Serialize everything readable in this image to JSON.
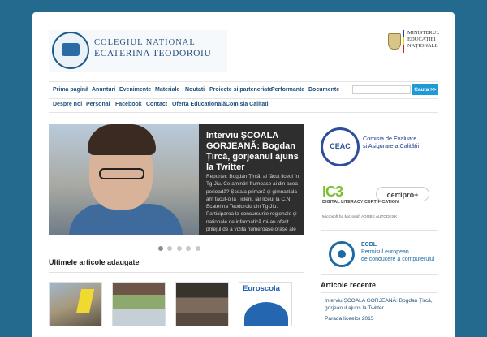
{
  "site": {
    "logo_line1": "COLEGIUL NATIONAL",
    "logo_line2": "ECATERINA TEODOROIU",
    "ministry_line1": "MINISTERUL",
    "ministry_line2": "EDUCAȚIEI",
    "ministry_line3": "NAȚIONALE"
  },
  "menu_primary": [
    "Prima pagină",
    "Anunturi",
    "Evenimente",
    "Materiale",
    "Noutati",
    "Proiecte si parteneriate",
    "Performante",
    "Documente"
  ],
  "menu_secondary": [
    "Despre noi",
    "Personal",
    "Facebook",
    "Contact",
    "Oferta Educațională",
    "Comisia Calitatii"
  ],
  "search": {
    "placeholder": "",
    "button": "Cauta >>"
  },
  "slider": {
    "title": "Interviu ȘCOALA GORJEANĂ: Bogdan Țircă, gorjeanul ajuns la Twitter",
    "excerpt": "Reporter: Bogdan Țircă, ai făcut liceul în Tg-Jiu. Ce amintiri frumoase ai din acea perioadă? Școala primară și gimnaziala am făcut-o la Ticleni, iar liceul la C.N. Ecaterina Teodoroiu din Tg-Jiu. Participarea la concursurile regionale și naționale de informatică mi-au oferit prilejul de a vizita numeroase orașe ale",
    "slides": 5,
    "active_slide": 1
  },
  "articles": {
    "heading": "Ultimele articole adaugate",
    "euroscola_label": "Euroscola"
  },
  "sidebar": {
    "ceac_logo": "CEAC",
    "ceac_text_line1": "Comisia de Evaluare",
    "ceac_text_line2": "și Asigurare a Calității",
    "ic3_label": "IC3",
    "ic3_sub": "DIGITAL LITERACY CERTIFICATION",
    "certiport_label": "certipro+",
    "brands": "Microsoft  hp  Microsoft  ADOBE  AUTODESK",
    "ecdl_title": "ECDL",
    "ecdl_line1": "Permisul european",
    "ecdl_line2": "de conducere a computerului",
    "recent_heading": "Articole recente",
    "recent_items": [
      "Interviu ȘCOALA GORJEANĂ: Bogdan Țircă, gorjeanul ajuns la Twitter",
      "Parada liceelor 2015"
    ]
  },
  "colors": {
    "background": "#236a8e",
    "nav_text": "#1f4f7a",
    "accent_button": "#1e9ad6"
  }
}
